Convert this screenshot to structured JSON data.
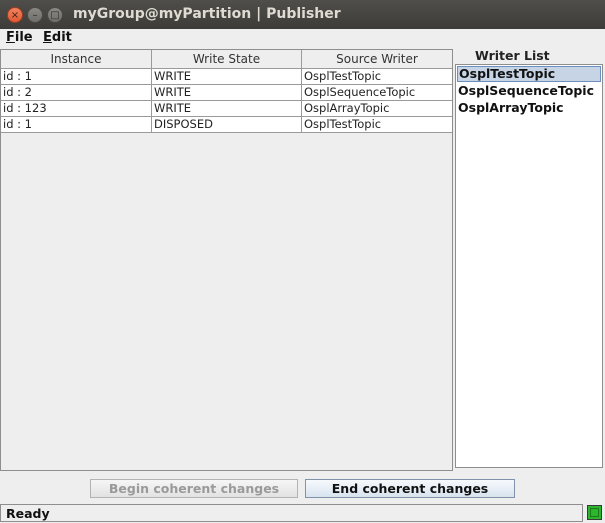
{
  "window": {
    "title": "myGroup@myPartition | Publisher",
    "close_glyph": "×",
    "minimize_glyph": "–",
    "maximize_glyph": "□"
  },
  "menu": {
    "items": [
      {
        "label": "File",
        "accent": "F",
        "rest": "ile"
      },
      {
        "label": "Edit",
        "accent": "E",
        "rest": "dit"
      }
    ]
  },
  "table": {
    "columns": [
      "Instance",
      "Write State",
      "Source Writer"
    ],
    "rows": [
      [
        "id : 1",
        "WRITE",
        "OsplTestTopic"
      ],
      [
        "id : 2",
        "WRITE",
        "OsplSequenceTopic"
      ],
      [
        "id : 123",
        "WRITE",
        "OsplArrayTopic"
      ],
      [
        "id : 1",
        "DISPOSED",
        "OsplTestTopic"
      ]
    ]
  },
  "writer_list": {
    "label": "Writer List",
    "items": [
      "OsplTestTopic",
      "OsplSequenceTopic",
      "OsplArrayTopic"
    ],
    "selected_index": 0
  },
  "buttons": {
    "begin": "Begin coherent changes",
    "end": "End coherent changes"
  },
  "status": {
    "text": "Ready",
    "indicator_color": "#2db52d"
  }
}
